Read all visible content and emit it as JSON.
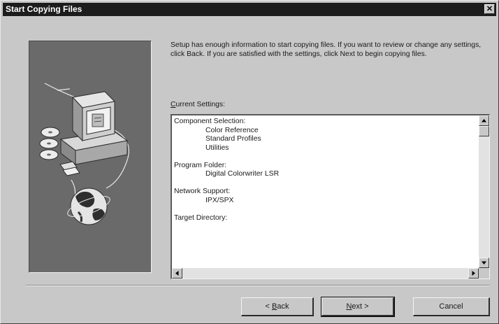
{
  "window": {
    "title": "Start Copying Files",
    "close_glyph": "✕"
  },
  "intro_text": "Setup has enough information to start copying files. If you want to review or change any settings, click Back. If you are satisfied with the settings, click Next to begin copying files.",
  "current_settings": {
    "label_first": "C",
    "label_rest": "urrent Settings:",
    "lines": [
      {
        "text": "Component Selection:",
        "indent": false
      },
      {
        "text": "Color Reference",
        "indent": true
      },
      {
        "text": "Standard Profiles",
        "indent": true
      },
      {
        "text": "Utilities",
        "indent": true
      },
      {
        "text": "",
        "indent": false
      },
      {
        "text": "Program Folder:",
        "indent": false
      },
      {
        "text": "Digital Colorwriter LSR",
        "indent": true
      },
      {
        "text": "",
        "indent": false
      },
      {
        "text": "Network Support:",
        "indent": false
      },
      {
        "text": "IPX/SPX",
        "indent": true
      },
      {
        "text": "",
        "indent": false
      },
      {
        "text": "Target Directory:",
        "indent": false
      }
    ]
  },
  "buttons": {
    "back_prefix": "< ",
    "back_hotkey": "B",
    "back_rest": "ack",
    "next_hotkey": "N",
    "next_rest": "ext >",
    "cancel": "Cancel"
  },
  "icons": {
    "illustration": "computer-with-disks-and-globe",
    "scroll_up": "arrow-up",
    "scroll_down": "arrow-down",
    "scroll_left": "arrow-left",
    "scroll_right": "arrow-right"
  }
}
